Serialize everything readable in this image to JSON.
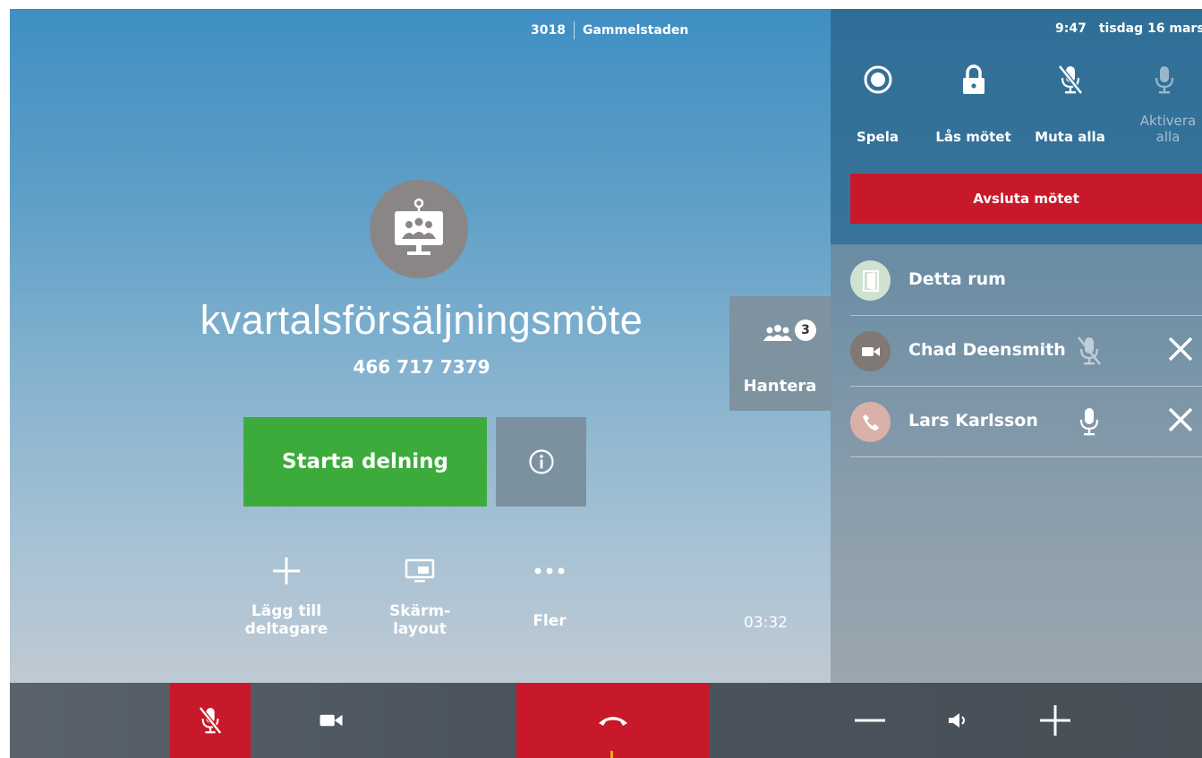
{
  "header": {
    "room_number": "3018",
    "room_name": "Gammelstaden",
    "time": "9:47",
    "date": "tisdag 16 mars"
  },
  "meeting": {
    "title": "kvartalsförsäljningsmöte",
    "number": "466 717 7379",
    "duration": "03:32"
  },
  "buttons": {
    "start_share": "Starta delning",
    "info_icon": "info-icon"
  },
  "actions": {
    "add_participant": {
      "label": "Lägg till deltagare",
      "icon": "plus-icon"
    },
    "screen_layout": {
      "label": "Skärm- layout",
      "icon": "monitor-icon"
    },
    "more": {
      "label": "Fler",
      "icon": "more-dots-icon"
    }
  },
  "hantera": {
    "label": "Hantera",
    "count": "3"
  },
  "panel": {
    "controls": [
      {
        "label": "Spela",
        "icon": "record-icon",
        "enabled": true
      },
      {
        "label": "Lås mötet",
        "icon": "lock-icon",
        "enabled": true
      },
      {
        "label": "Muta alla",
        "icon": "mic-off-icon",
        "enabled": true
      },
      {
        "label": "Aktivera alla",
        "icon": "mic-icon",
        "enabled": false
      }
    ],
    "end_meeting": "Avsluta mötet",
    "participants": [
      {
        "name": "Detta rum",
        "type": "room",
        "avatar_color": "#cfe2d2"
      },
      {
        "name": "Chad Deensmith",
        "type": "video",
        "avatar_color": "#7f7874",
        "mic": "muted"
      },
      {
        "name": "Lars Karlsson",
        "type": "phone",
        "avatar_color": "#d9b1a8",
        "mic": "on"
      }
    ]
  },
  "bottom_bar": {
    "mic": "muted",
    "accent": "#c8192a",
    "share_color": "#3cab3c"
  }
}
